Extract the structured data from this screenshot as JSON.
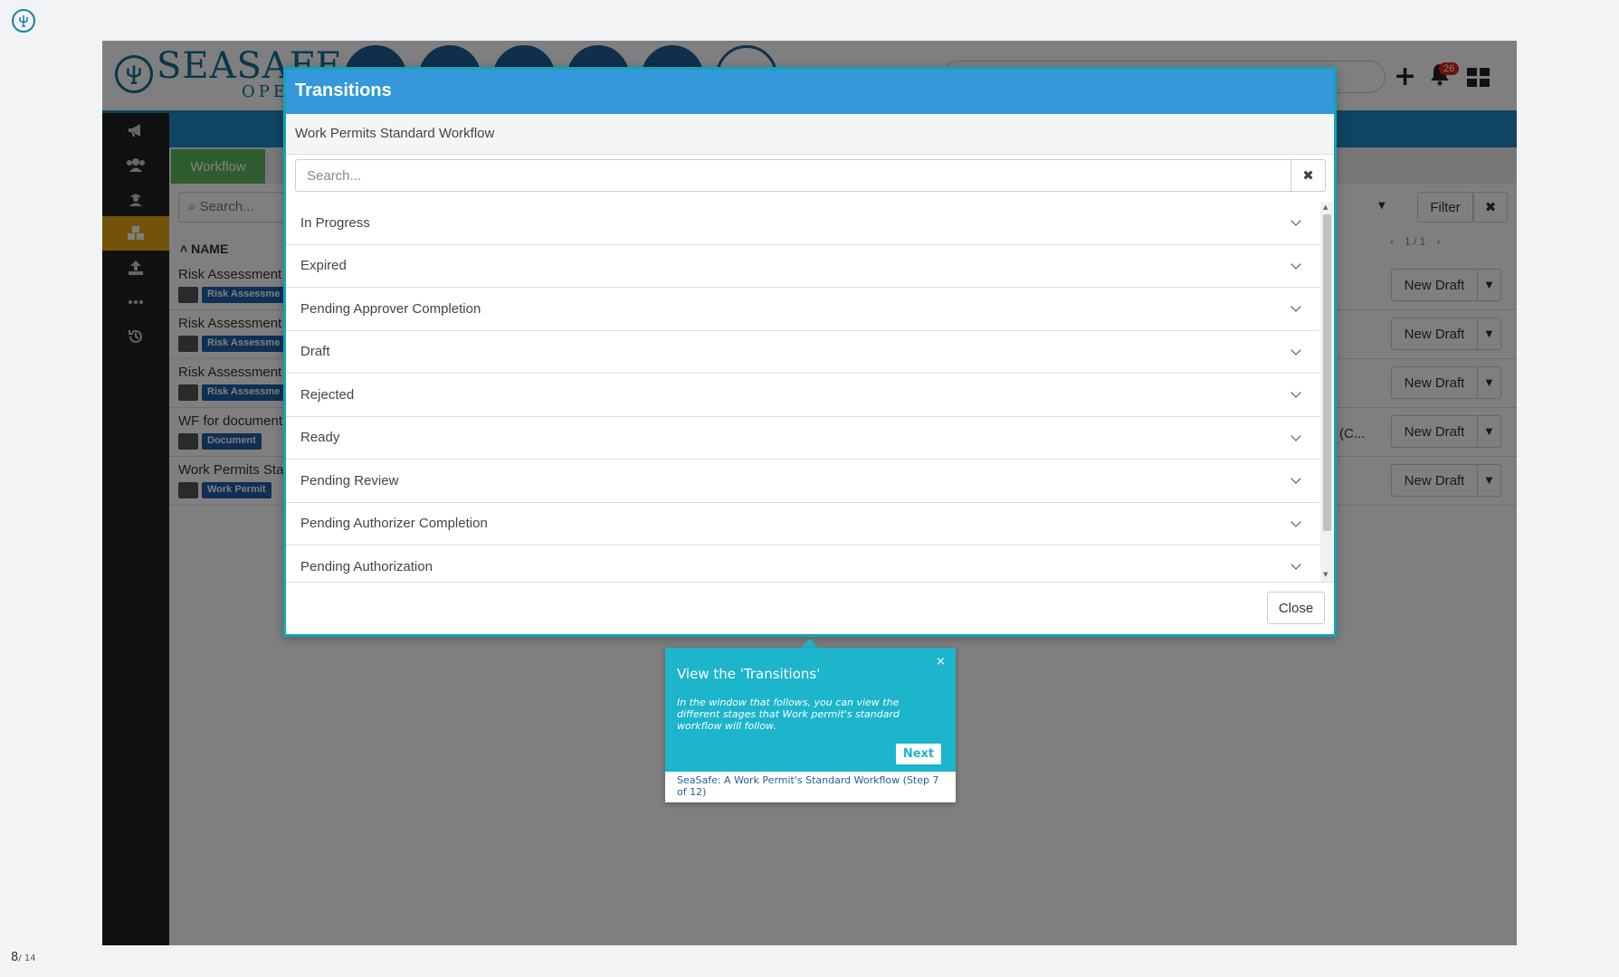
{
  "player": {
    "step_current": "8",
    "step_total": "/ 14"
  },
  "app": {
    "brand_line1": "SEASAFE",
    "brand_line2": "OPERATIONS",
    "notification_count": "26",
    "accent_color": "#1e88c7",
    "sidebar_icons": [
      "megaphone-icon",
      "users-icon",
      "user-hat-icon",
      "cubes-icon",
      "upload-icon",
      "ellipsis-icon",
      "history-icon"
    ],
    "sidebar_active_index": 3,
    "workflow_tab": "Workflow",
    "list_search_placeholder": "Search...",
    "column_name": "NAME",
    "filter_label": "Filter",
    "pager": {
      "prev": "‹",
      "page": "1 / 1",
      "next": "›"
    },
    "new_draft_label": "New Draft",
    "rows": [
      {
        "title": "Risk Assessment",
        "tag": "Risk Assessme"
      },
      {
        "title": "Risk Assessment",
        "tag": "Risk Assessme"
      },
      {
        "title": "Risk Assessment",
        "tag": "Risk Assessme"
      },
      {
        "title": "WF for document",
        "tag": "Document",
        "extra": "(C..."
      },
      {
        "title": "Work Permits Sta",
        "tag": "Work Permit"
      }
    ]
  },
  "modal": {
    "title": "Transitions",
    "subtitle": "Work Permits Standard Workflow",
    "search_placeholder": "Search...",
    "clear_label": "✖",
    "transitions": [
      "In Progress",
      "Expired",
      "Pending Approver Completion",
      "Draft",
      "Rejected",
      "Ready",
      "Pending Review",
      "Pending Authorizer Completion",
      "Pending Authorization"
    ],
    "close_label": "Close"
  },
  "tour": {
    "close_label": "×",
    "title": "View the 'Transitions'",
    "body": "In the window that follows, you can view the different stages that Work permit's standard workflow will follow.",
    "next_label": "Next",
    "footer": "SeaSafe: A Work Permit's Standard Workflow (Step 7 of 12)"
  }
}
